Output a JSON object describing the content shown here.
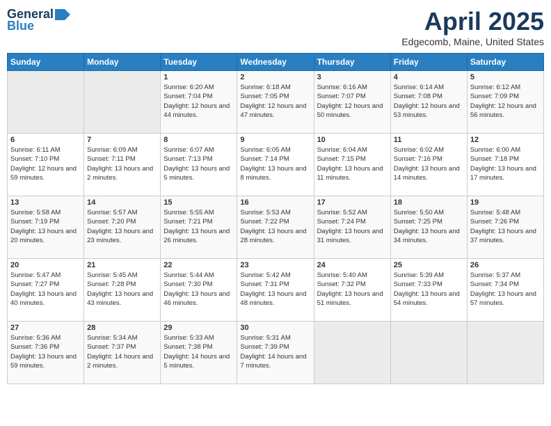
{
  "header": {
    "logo_general": "General",
    "logo_blue": "Blue",
    "month_title": "April 2025",
    "location": "Edgecomb, Maine, United States"
  },
  "days_of_week": [
    "Sunday",
    "Monday",
    "Tuesday",
    "Wednesday",
    "Thursday",
    "Friday",
    "Saturday"
  ],
  "weeks": [
    [
      {
        "day": "",
        "sunrise": "",
        "sunset": "",
        "daylight": ""
      },
      {
        "day": "",
        "sunrise": "",
        "sunset": "",
        "daylight": ""
      },
      {
        "day": "1",
        "sunrise": "Sunrise: 6:20 AM",
        "sunset": "Sunset: 7:04 PM",
        "daylight": "Daylight: 12 hours and 44 minutes."
      },
      {
        "day": "2",
        "sunrise": "Sunrise: 6:18 AM",
        "sunset": "Sunset: 7:05 PM",
        "daylight": "Daylight: 12 hours and 47 minutes."
      },
      {
        "day": "3",
        "sunrise": "Sunrise: 6:16 AM",
        "sunset": "Sunset: 7:07 PM",
        "daylight": "Daylight: 12 hours and 50 minutes."
      },
      {
        "day": "4",
        "sunrise": "Sunrise: 6:14 AM",
        "sunset": "Sunset: 7:08 PM",
        "daylight": "Daylight: 12 hours and 53 minutes."
      },
      {
        "day": "5",
        "sunrise": "Sunrise: 6:12 AM",
        "sunset": "Sunset: 7:09 PM",
        "daylight": "Daylight: 12 hours and 56 minutes."
      }
    ],
    [
      {
        "day": "6",
        "sunrise": "Sunrise: 6:11 AM",
        "sunset": "Sunset: 7:10 PM",
        "daylight": "Daylight: 12 hours and 59 minutes."
      },
      {
        "day": "7",
        "sunrise": "Sunrise: 6:09 AM",
        "sunset": "Sunset: 7:11 PM",
        "daylight": "Daylight: 13 hours and 2 minutes."
      },
      {
        "day": "8",
        "sunrise": "Sunrise: 6:07 AM",
        "sunset": "Sunset: 7:13 PM",
        "daylight": "Daylight: 13 hours and 5 minutes."
      },
      {
        "day": "9",
        "sunrise": "Sunrise: 6:05 AM",
        "sunset": "Sunset: 7:14 PM",
        "daylight": "Daylight: 13 hours and 8 minutes."
      },
      {
        "day": "10",
        "sunrise": "Sunrise: 6:04 AM",
        "sunset": "Sunset: 7:15 PM",
        "daylight": "Daylight: 13 hours and 11 minutes."
      },
      {
        "day": "11",
        "sunrise": "Sunrise: 6:02 AM",
        "sunset": "Sunset: 7:16 PM",
        "daylight": "Daylight: 13 hours and 14 minutes."
      },
      {
        "day": "12",
        "sunrise": "Sunrise: 6:00 AM",
        "sunset": "Sunset: 7:18 PM",
        "daylight": "Daylight: 13 hours and 17 minutes."
      }
    ],
    [
      {
        "day": "13",
        "sunrise": "Sunrise: 5:58 AM",
        "sunset": "Sunset: 7:19 PM",
        "daylight": "Daylight: 13 hours and 20 minutes."
      },
      {
        "day": "14",
        "sunrise": "Sunrise: 5:57 AM",
        "sunset": "Sunset: 7:20 PM",
        "daylight": "Daylight: 13 hours and 23 minutes."
      },
      {
        "day": "15",
        "sunrise": "Sunrise: 5:55 AM",
        "sunset": "Sunset: 7:21 PM",
        "daylight": "Daylight: 13 hours and 26 minutes."
      },
      {
        "day": "16",
        "sunrise": "Sunrise: 5:53 AM",
        "sunset": "Sunset: 7:22 PM",
        "daylight": "Daylight: 13 hours and 28 minutes."
      },
      {
        "day": "17",
        "sunrise": "Sunrise: 5:52 AM",
        "sunset": "Sunset: 7:24 PM",
        "daylight": "Daylight: 13 hours and 31 minutes."
      },
      {
        "day": "18",
        "sunrise": "Sunrise: 5:50 AM",
        "sunset": "Sunset: 7:25 PM",
        "daylight": "Daylight: 13 hours and 34 minutes."
      },
      {
        "day": "19",
        "sunrise": "Sunrise: 5:48 AM",
        "sunset": "Sunset: 7:26 PM",
        "daylight": "Daylight: 13 hours and 37 minutes."
      }
    ],
    [
      {
        "day": "20",
        "sunrise": "Sunrise: 5:47 AM",
        "sunset": "Sunset: 7:27 PM",
        "daylight": "Daylight: 13 hours and 40 minutes."
      },
      {
        "day": "21",
        "sunrise": "Sunrise: 5:45 AM",
        "sunset": "Sunset: 7:28 PM",
        "daylight": "Daylight: 13 hours and 43 minutes."
      },
      {
        "day": "22",
        "sunrise": "Sunrise: 5:44 AM",
        "sunset": "Sunset: 7:30 PM",
        "daylight": "Daylight: 13 hours and 46 minutes."
      },
      {
        "day": "23",
        "sunrise": "Sunrise: 5:42 AM",
        "sunset": "Sunset: 7:31 PM",
        "daylight": "Daylight: 13 hours and 48 minutes."
      },
      {
        "day": "24",
        "sunrise": "Sunrise: 5:40 AM",
        "sunset": "Sunset: 7:32 PM",
        "daylight": "Daylight: 13 hours and 51 minutes."
      },
      {
        "day": "25",
        "sunrise": "Sunrise: 5:39 AM",
        "sunset": "Sunset: 7:33 PM",
        "daylight": "Daylight: 13 hours and 54 minutes."
      },
      {
        "day": "26",
        "sunrise": "Sunrise: 5:37 AM",
        "sunset": "Sunset: 7:34 PM",
        "daylight": "Daylight: 13 hours and 57 minutes."
      }
    ],
    [
      {
        "day": "27",
        "sunrise": "Sunrise: 5:36 AM",
        "sunset": "Sunset: 7:36 PM",
        "daylight": "Daylight: 13 hours and 59 minutes."
      },
      {
        "day": "28",
        "sunrise": "Sunrise: 5:34 AM",
        "sunset": "Sunset: 7:37 PM",
        "daylight": "Daylight: 14 hours and 2 minutes."
      },
      {
        "day": "29",
        "sunrise": "Sunrise: 5:33 AM",
        "sunset": "Sunset: 7:38 PM",
        "daylight": "Daylight: 14 hours and 5 minutes."
      },
      {
        "day": "30",
        "sunrise": "Sunrise: 5:31 AM",
        "sunset": "Sunset: 7:39 PM",
        "daylight": "Daylight: 14 hours and 7 minutes."
      },
      {
        "day": "",
        "sunrise": "",
        "sunset": "",
        "daylight": ""
      },
      {
        "day": "",
        "sunrise": "",
        "sunset": "",
        "daylight": ""
      },
      {
        "day": "",
        "sunrise": "",
        "sunset": "",
        "daylight": ""
      }
    ]
  ]
}
